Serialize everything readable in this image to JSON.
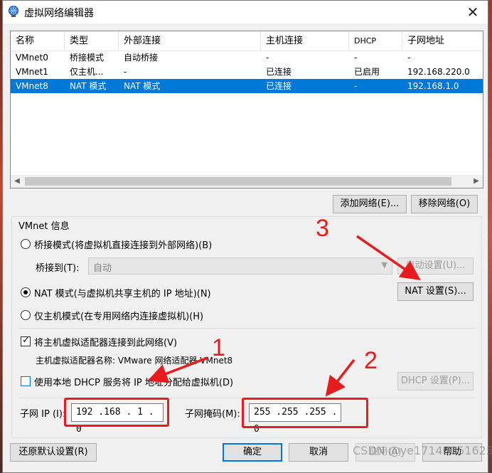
{
  "window": {
    "title": "虚拟网络编辑器",
    "close": "✕"
  },
  "list": {
    "columns": [
      "名称",
      "类型",
      "外部连接",
      "主机连接",
      "DHCP",
      "子网地址"
    ],
    "rows": [
      [
        "VMnet0",
        "桥接模式",
        "自动桥接",
        "-",
        "-",
        "-"
      ],
      [
        "VMnet1",
        "仅主机...",
        "-",
        "已连接",
        "已启用",
        "192.168.220.0"
      ],
      [
        "VMnet8",
        "NAT 模式",
        "NAT 模式",
        "已连接",
        "-",
        "192.168.1.0"
      ]
    ],
    "selected_row": 2
  },
  "buttons": {
    "add_network": "添加网络(E)...",
    "remove_network": "移除网络(O)",
    "auto_settings": "自动设置(U)...",
    "nat_settings": "NAT 设置(S)...",
    "dhcp_settings": "DHCP 设置(P)...",
    "restore_defaults": "还原默认设置(R)",
    "ok": "确定",
    "cancel": "取消",
    "apply": "应用(A)",
    "help": "帮助"
  },
  "vmnet_info": {
    "label": "VMnet 信息",
    "bridged_mode": "桥接模式(将虚拟机直接连接到外部网络)(B)",
    "bridged_to_label": "桥接到(T):",
    "bridged_to_value": "自动",
    "nat_mode": "NAT 模式(与虚拟机共享主机的 IP 地址)(N)",
    "host_only_mode": "仅主机模式(在专用网络内连接虚拟机)(H)",
    "connect_adapter": "将主机虚拟适配器连接到此网络(V)",
    "adapter_name": "主机虚拟适配器名称: VMware 网络适配器 VMnet8",
    "use_dhcp": "使用本地 DHCP 服务将 IP 地址分配给虚拟机(D)",
    "subnet_ip_label": "子网 IP (I):",
    "subnet_ip": "192 .168 . 1 . 0",
    "subnet_mask_label": "子网掩码(M):",
    "subnet_mask": "255 .255 .255 . 0",
    "selected_mode": "nat",
    "connect_adapter_checked": true,
    "use_dhcp_checked": false
  },
  "annotations": {
    "n1": "1",
    "n2": "2",
    "n3": "3",
    "color": "#e81c1c"
  },
  "watermark": "CSDN @ye17145051625"
}
